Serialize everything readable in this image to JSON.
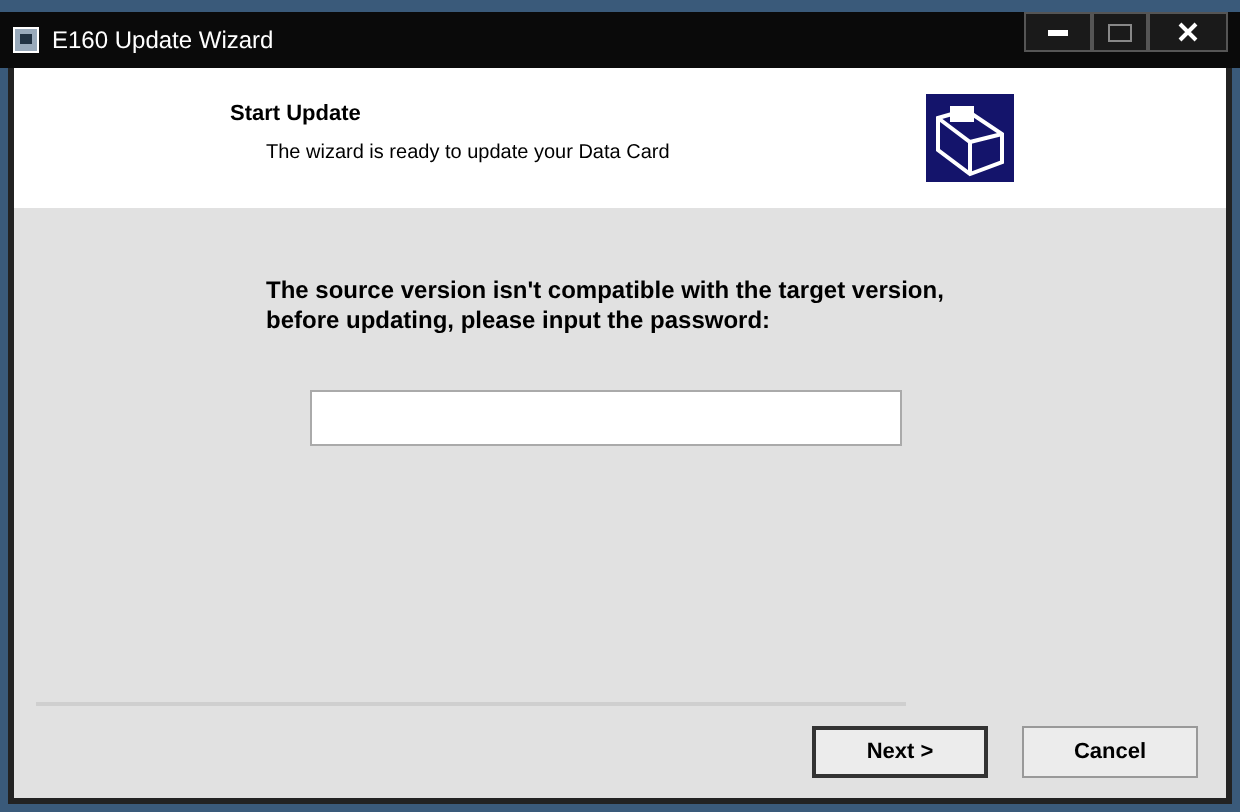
{
  "window": {
    "title": "E160 Update Wizard"
  },
  "header": {
    "title": "Start Update",
    "subtitle": "The wizard is ready to update your Data Card"
  },
  "message": "The source version isn't compatible with the target version, before updating, please input the password:",
  "buttons": [
    {
      "label": "Next >",
      "default": true
    },
    {
      "label": "Cancel",
      "default": false
    }
  ]
}
